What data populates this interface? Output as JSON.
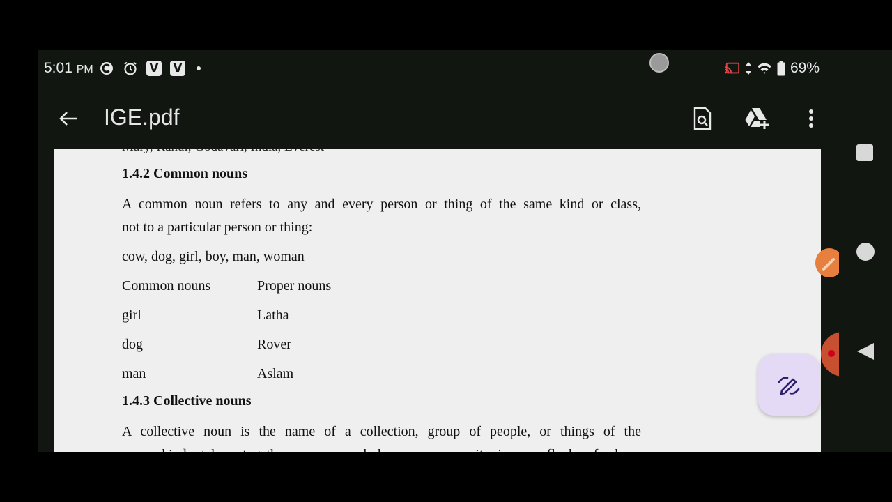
{
  "status_bar": {
    "time": "5:01",
    "ampm": "PM",
    "battery": "69%",
    "left_icons": [
      "c-icon",
      "alarm-icon",
      "vivaldi-icon",
      "vivaldi-icon",
      "notification-dot"
    ],
    "right_icons": [
      "cast-icon",
      "data-arrows-icon",
      "wifi-icon",
      "battery-icon"
    ]
  },
  "app_bar": {
    "title": "IGE.pdf",
    "actions": [
      "find-in-document-icon",
      "add-to-drive-icon",
      "more-vert-icon"
    ]
  },
  "document": {
    "cut_top_line": "Mary, Rahul, Godavari, India, Everest",
    "section_142": {
      "heading": "1.4.2 Common nouns",
      "para_line1": "A common noun refers to any and every person or thing of the same kind or class,",
      "para_line2": "not to a particular person or thing:",
      "examples": "cow, dog, girl, boy, man, woman"
    },
    "table": {
      "headers": [
        "Common nouns",
        "Proper nouns"
      ],
      "rows": [
        [
          "girl",
          "Latha"
        ],
        [
          "dog",
          "Rover"
        ],
        [
          "man",
          "Aslam"
        ]
      ]
    },
    "section_143": {
      "heading": "1.4.3 Collective nouns",
      "para_line1": "A collective noun is the name of a collection, group of people, or things of the",
      "para_line2_cut": "same kind, taken together as one whole or as a unit, i.e., a flock of sheep"
    }
  },
  "colors": {
    "background": "#111611",
    "page": "#efefef",
    "fab": "#e4daf5",
    "fab_icon": "#2b1f6a"
  }
}
